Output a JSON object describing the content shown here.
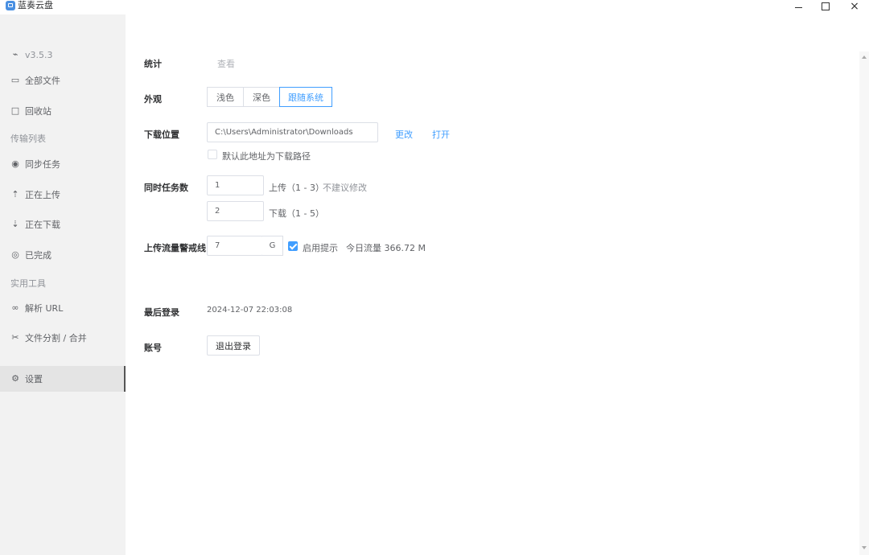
{
  "app": {
    "title": "蓝奏云盘"
  },
  "window": {
    "minimize": "−",
    "maximize": "□",
    "close": "×"
  },
  "sidebar": {
    "version": "v3.5.3",
    "items": [
      {
        "label": "全部文件",
        "icon": "folder-icon"
      },
      {
        "label": "回收站",
        "icon": "trash-icon"
      },
      {
        "label": "同步任务",
        "icon": "sync-icon"
      },
      {
        "label": "正在上传",
        "icon": "upload-icon"
      },
      {
        "label": "正在下载",
        "icon": "download-icon"
      },
      {
        "label": "已完成",
        "icon": "check-circle-icon"
      },
      {
        "label": "解析 URL",
        "icon": "link-icon"
      },
      {
        "label": "文件分割 / 合并",
        "icon": "scissors-icon"
      },
      {
        "label": "设置",
        "icon": "gear-icon"
      }
    ],
    "groups": {
      "transfer": "传输列表",
      "tools": "实用工具"
    }
  },
  "settings": {
    "stats": {
      "label": "统计",
      "action": "查看"
    },
    "appearance": {
      "label": "外观",
      "options": [
        "浅色",
        "深色",
        "跟随系统"
      ],
      "selected": "跟随系统"
    },
    "download_location": {
      "label": "下载位置",
      "path": "C:\\Users\\Administrator\\Downloads",
      "change": "更改",
      "open": "打开",
      "default_checkbox_label": "默认此地址为下载路径",
      "default_checked": false
    },
    "concurrent_tasks": {
      "label": "同时任务数",
      "upload_value": "1",
      "upload_label": "上传（1 - 3）",
      "upload_note": "不建议修改",
      "download_value": "2",
      "download_label": "下载（1 - 5）"
    },
    "upload_traffic": {
      "label": "上传流量警戒线",
      "value": "7",
      "unit": "G",
      "enable_label": "启用提示",
      "enabled": true,
      "today_traffic": "今日流量 366.72 M"
    },
    "last_login": {
      "label": "最后登录",
      "value": "2024-12-07 22:03:08"
    },
    "account": {
      "label": "账号",
      "logout": "退出登录"
    }
  },
  "colors": {
    "accent": "#409eff",
    "sidebar_bg": "#f2f2f2",
    "active_item_bg": "#e4e4e4"
  }
}
